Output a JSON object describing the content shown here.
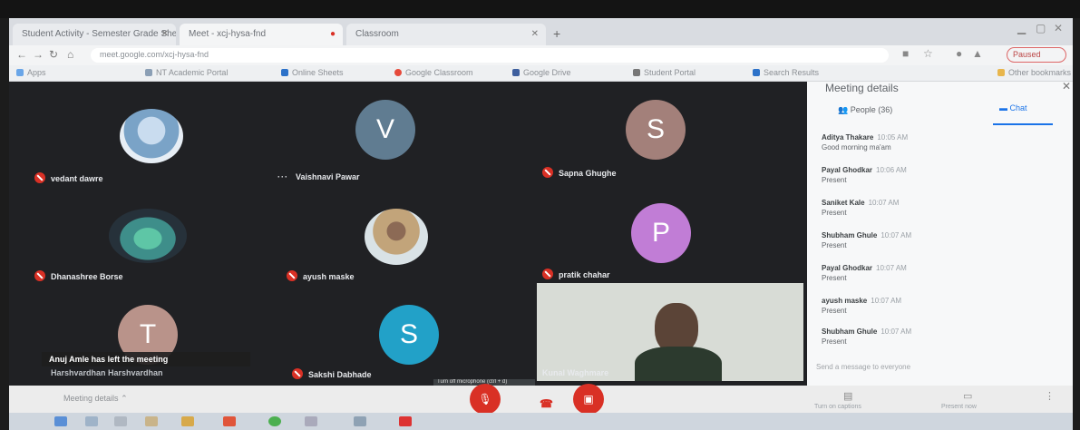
{
  "browser": {
    "tabs": [
      {
        "label": "Student Activity - Semester Grade Sheets"
      },
      {
        "label": "Meet - xcj-hysa-fnd"
      },
      {
        "label": "Classroom"
      }
    ],
    "new_tab": "+",
    "omnibox_text": "meet.google.com/xcj-hysa-fnd",
    "profile_label": "Paused",
    "bookmarks": [
      {
        "label": "Apps",
        "color": "#6aa6e8"
      },
      {
        "label": "NT Academic Portal",
        "color": "#8b9fb5"
      },
      {
        "label": "Online Sheets",
        "color": "#2d72c9"
      },
      {
        "label": "Google Classroom",
        "color": "#e64a3b"
      },
      {
        "label": "Google Drive",
        "color": "#3e5f9e"
      },
      {
        "label": "Student Portal",
        "color": "#777"
      },
      {
        "label": "Search Results",
        "color": "#2d72c9"
      }
    ],
    "other_bookmarks": "Other bookmarks"
  },
  "participants": [
    {
      "name": "vedant dawre",
      "type": "photo",
      "photo_color": "#7aa3c7",
      "muted": true
    },
    {
      "name": "Vaishnavi Pawar",
      "type": "letter",
      "letter": "V",
      "color": "#607c91",
      "muted": false
    },
    {
      "name": "Sapna Ghughe",
      "type": "letter",
      "letter": "S",
      "color": "#a3807a",
      "muted": true
    },
    {
      "name": "Dhanashree Borse",
      "type": "photo",
      "photo_color": "#3e8e8a",
      "muted": true
    },
    {
      "name": "ayush maske",
      "type": "photo",
      "photo_color": "#c2a47a",
      "muted": true
    },
    {
      "name": "pratik chahar",
      "type": "letter",
      "letter": "P",
      "color": "#c17dd6",
      "muted": true
    },
    {
      "name": "Harshvardhan Harshvardhan",
      "type": "letter",
      "letter": "T",
      "color": "#b9938a",
      "muted": false
    },
    {
      "name": "Sakshi Dabhade",
      "type": "letter",
      "letter": "S",
      "color": "#22a1c8",
      "muted": true
    }
  ],
  "self_view": {
    "name": "Kunal Waghmare"
  },
  "toast": "Anuj Amle has left the meeting",
  "controls": {
    "meeting_details": "Meeting details",
    "tooltip": "Turn off microphone (ctrl + d)",
    "captions_label": "Turn on captions",
    "present_label": "Present now"
  },
  "panel": {
    "title": "Meeting details",
    "people_tab": "People (36)",
    "chat_tab": "Chat",
    "messages": [
      {
        "sender": "Aditya Thakare",
        "time": "10:05 AM",
        "text": "Good morning ma'am"
      },
      {
        "sender": "Payal Ghodkar",
        "time": "10:06 AM",
        "text": "Present"
      },
      {
        "sender": "Saniket Kale",
        "time": "10:07 AM",
        "text": "Present"
      },
      {
        "sender": "Shubham Ghule",
        "time": "10:07 AM",
        "text": "Present"
      },
      {
        "sender": "Payal Ghodkar",
        "time": "10:07 AM",
        "text": "Present"
      },
      {
        "sender": "ayush maske",
        "time": "10:07 AM",
        "text": "Present"
      },
      {
        "sender": "Shubham Ghule",
        "time": "10:07 AM",
        "text": "Present"
      }
    ],
    "input_placeholder": "Send a message to everyone"
  }
}
